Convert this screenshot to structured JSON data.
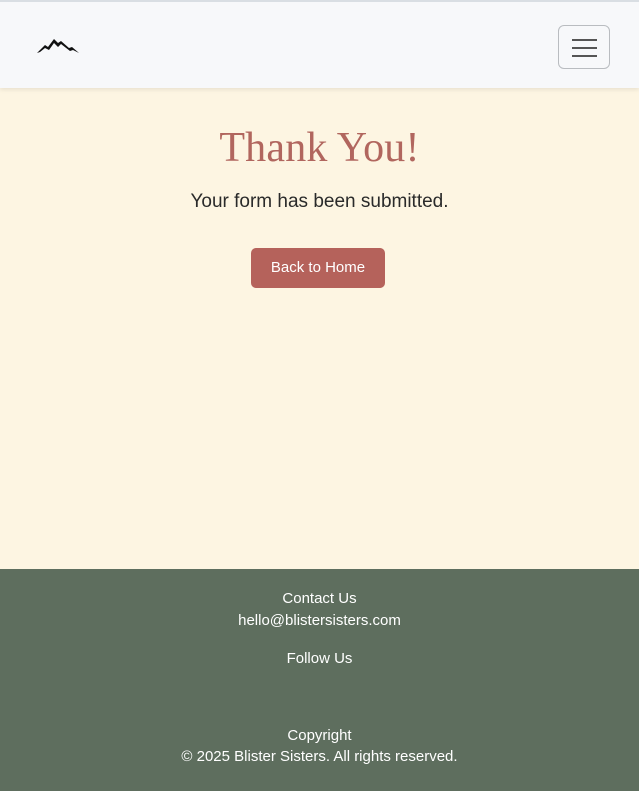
{
  "navbar": {
    "logo_icon": "mountain-logo-icon",
    "menu_icon": "hamburger-menu-icon"
  },
  "main": {
    "title": "Thank You!",
    "subtitle": "Your form has been submitted.",
    "home_button_label": "Back to Home"
  },
  "footer": {
    "contact_heading": "Contact Us",
    "contact_email": "hello@blistersisters.com",
    "follow_heading": "Follow Us",
    "copyright_heading": "Copyright",
    "copyright_text": "© 2025 Blister Sisters. All rights reserved."
  },
  "colors": {
    "accent": "#b5625b",
    "title": "#b1665e",
    "content_bg": "#fdf5e2",
    "footer_bg": "#5e6e5e",
    "navbar_bg": "#f7f8fa"
  }
}
